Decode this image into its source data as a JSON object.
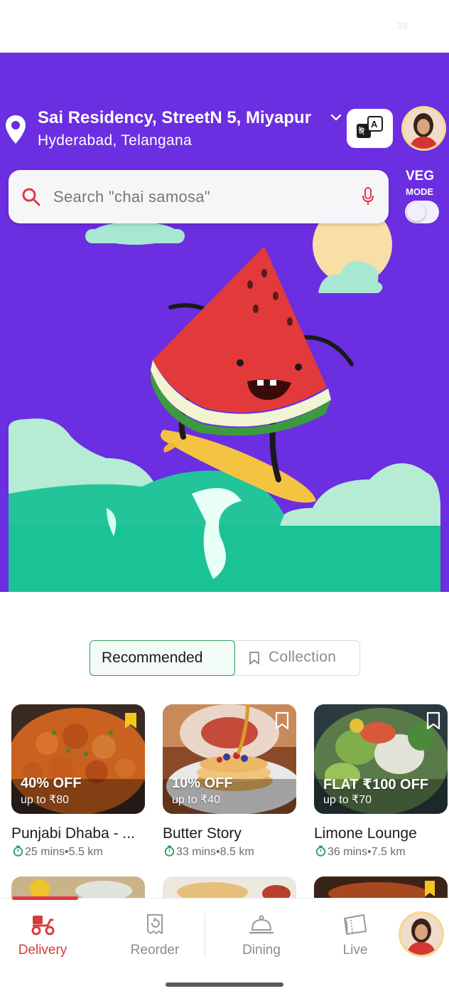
{
  "status_bar": {
    "number": "39"
  },
  "header": {
    "location_title": "Sai Residency, StreetN 5, Miyapur",
    "location_subtitle": "Hyderabad, Telangana",
    "lang_icon": "translate-icon"
  },
  "search": {
    "placeholder": "Search \"chai samosa\""
  },
  "veg_mode": {
    "label": "VEG",
    "sublabel": "MODE",
    "enabled": false
  },
  "tabs": [
    {
      "label": "Recommended",
      "active": true
    },
    {
      "label": "Collection",
      "active": false
    }
  ],
  "restaurants": [
    {
      "name": "Punjabi Dhaba - ...",
      "offer": "40% OFF",
      "offer_sub": "up to ₹80",
      "meta": "25 mins•5.5 km",
      "bookmarked": true
    },
    {
      "name": "Butter Story",
      "offer": "10% OFF",
      "offer_sub": "up to ₹40",
      "meta": "33 mins•8.5 km",
      "bookmarked": false
    },
    {
      "name": "Limone Lounge",
      "offer": "FLAT ₹100 OFF",
      "offer_sub": "up to ₹70",
      "meta": "36 mins•7.5 km",
      "bookmarked": true
    }
  ],
  "bottom_nav": [
    {
      "label": "Delivery",
      "icon": "scooter-icon",
      "active": true
    },
    {
      "label": "Reorder",
      "icon": "reorder-icon",
      "active": false
    },
    {
      "label": "Dining",
      "icon": "cloche-icon",
      "active": false
    },
    {
      "label": "Live",
      "icon": "ticket-icon",
      "active": false
    }
  ],
  "colors": {
    "hero_bg": "#6b2ee0",
    "accent_red": "#e23744",
    "tab_green": "#2e9d5e"
  }
}
